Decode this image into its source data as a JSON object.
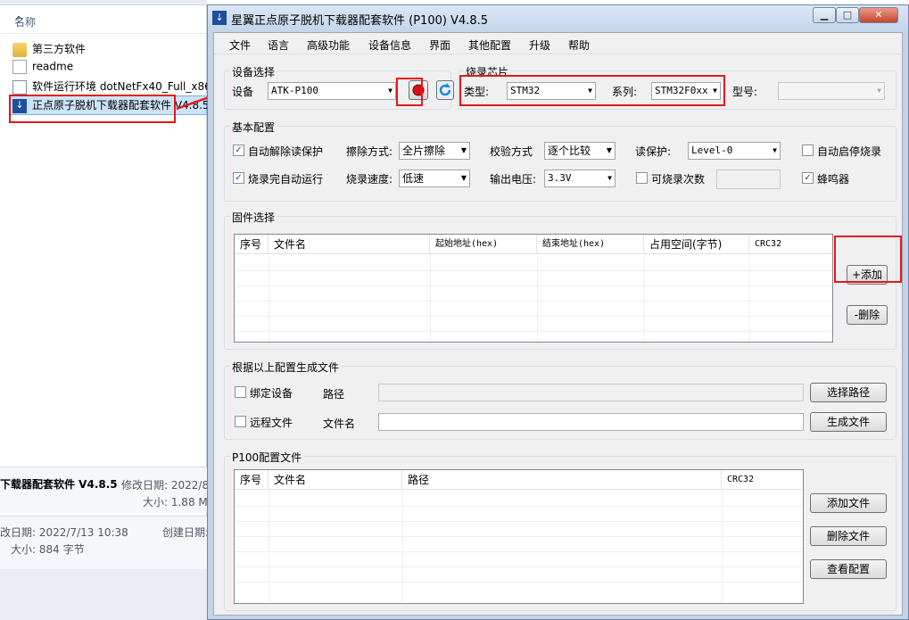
{
  "explorer": {
    "column_name": "名称",
    "files": [
      {
        "name": "第三方软件",
        "icon": "folder-icon"
      },
      {
        "name": "readme",
        "icon": "document-icon"
      },
      {
        "name": "软件运行环境 dotNetFx40_Full_x86",
        "icon": "installer-icon"
      },
      {
        "name": "正点原子脱机下载器配套软件 V4.8.5",
        "icon": "app-download-icon"
      }
    ],
    "details1": {
      "title": "下载器配套软件 V4.8.5",
      "modified_label": "修改日期: 2022/8",
      "size_label": "大小: 1.88 M"
    },
    "details2": {
      "modified_label": "改日期: 2022/7/13 10:38",
      "created_label": "创建日期:",
      "size_label": "大小: 884 字节"
    }
  },
  "window": {
    "title": "星翼正点原子脱机下载器配套软件 (P100)  V4.8.5",
    "controls": {
      "minimize": "▁",
      "maximize": "□",
      "close": "✕"
    }
  },
  "menu": [
    "文件",
    "语言",
    "高级功能",
    "设备信息",
    "界面",
    "其他配置",
    "升级",
    "帮助"
  ],
  "device": {
    "group_title": "设备选择",
    "label": "设备",
    "value": "ATK-P100"
  },
  "chip": {
    "group_title": "烧录芯片",
    "type_label": "类型:",
    "type_value": "STM32",
    "series_label": "系列:",
    "series_value": "STM32F0xx",
    "model_label": "型号:",
    "model_value": ""
  },
  "basic": {
    "group_title": "基本配置",
    "auto_unprotect": {
      "label": "自动解除读保护",
      "checked": true
    },
    "auto_run": {
      "label": "烧录完自动运行",
      "checked": true
    },
    "erase_label": "擦除方式:",
    "erase_value": "全片擦除",
    "speed_label": "烧录速度:",
    "speed_value": "低速",
    "verify_label": "校验方式",
    "verify_value": "逐个比较",
    "voltage_label": "输出电压:",
    "voltage_value": "3.3V",
    "read_protect_label": "读保护:",
    "read_protect_value": "Level-0",
    "burn_count": {
      "label": "可烧录次数",
      "checked": false
    },
    "auto_start": {
      "label": "自动启停烧录",
      "checked": false
    },
    "buzzer": {
      "label": "蜂鸣器",
      "checked": true
    }
  },
  "firmware": {
    "group_title": "固件选择",
    "columns": [
      "序号",
      "文件名",
      "起始地址(hex)",
      "结束地址(hex)",
      "占用空间(字节)",
      "CRC32"
    ],
    "add_button": "+添加",
    "delete_button": "-删除"
  },
  "generate": {
    "group_title": "根据以上配置生成文件",
    "bind_device": {
      "label": "绑定设备",
      "checked": false
    },
    "remote_file": {
      "label": "远程文件",
      "checked": false
    },
    "path_label": "路径",
    "filename_label": "文件名",
    "select_path_button": "选择路径",
    "generate_button": "生成文件"
  },
  "p100": {
    "group_title": "P100配置文件",
    "columns": [
      "序号",
      "文件名",
      "路径",
      "CRC32"
    ],
    "add_button": "添加文件",
    "delete_button": "删除文件",
    "view_button": "查看配置"
  },
  "colors": {
    "highlight": "#e8151b",
    "title_bar": "#c4d5eb",
    "client": "#f0f0f0"
  }
}
